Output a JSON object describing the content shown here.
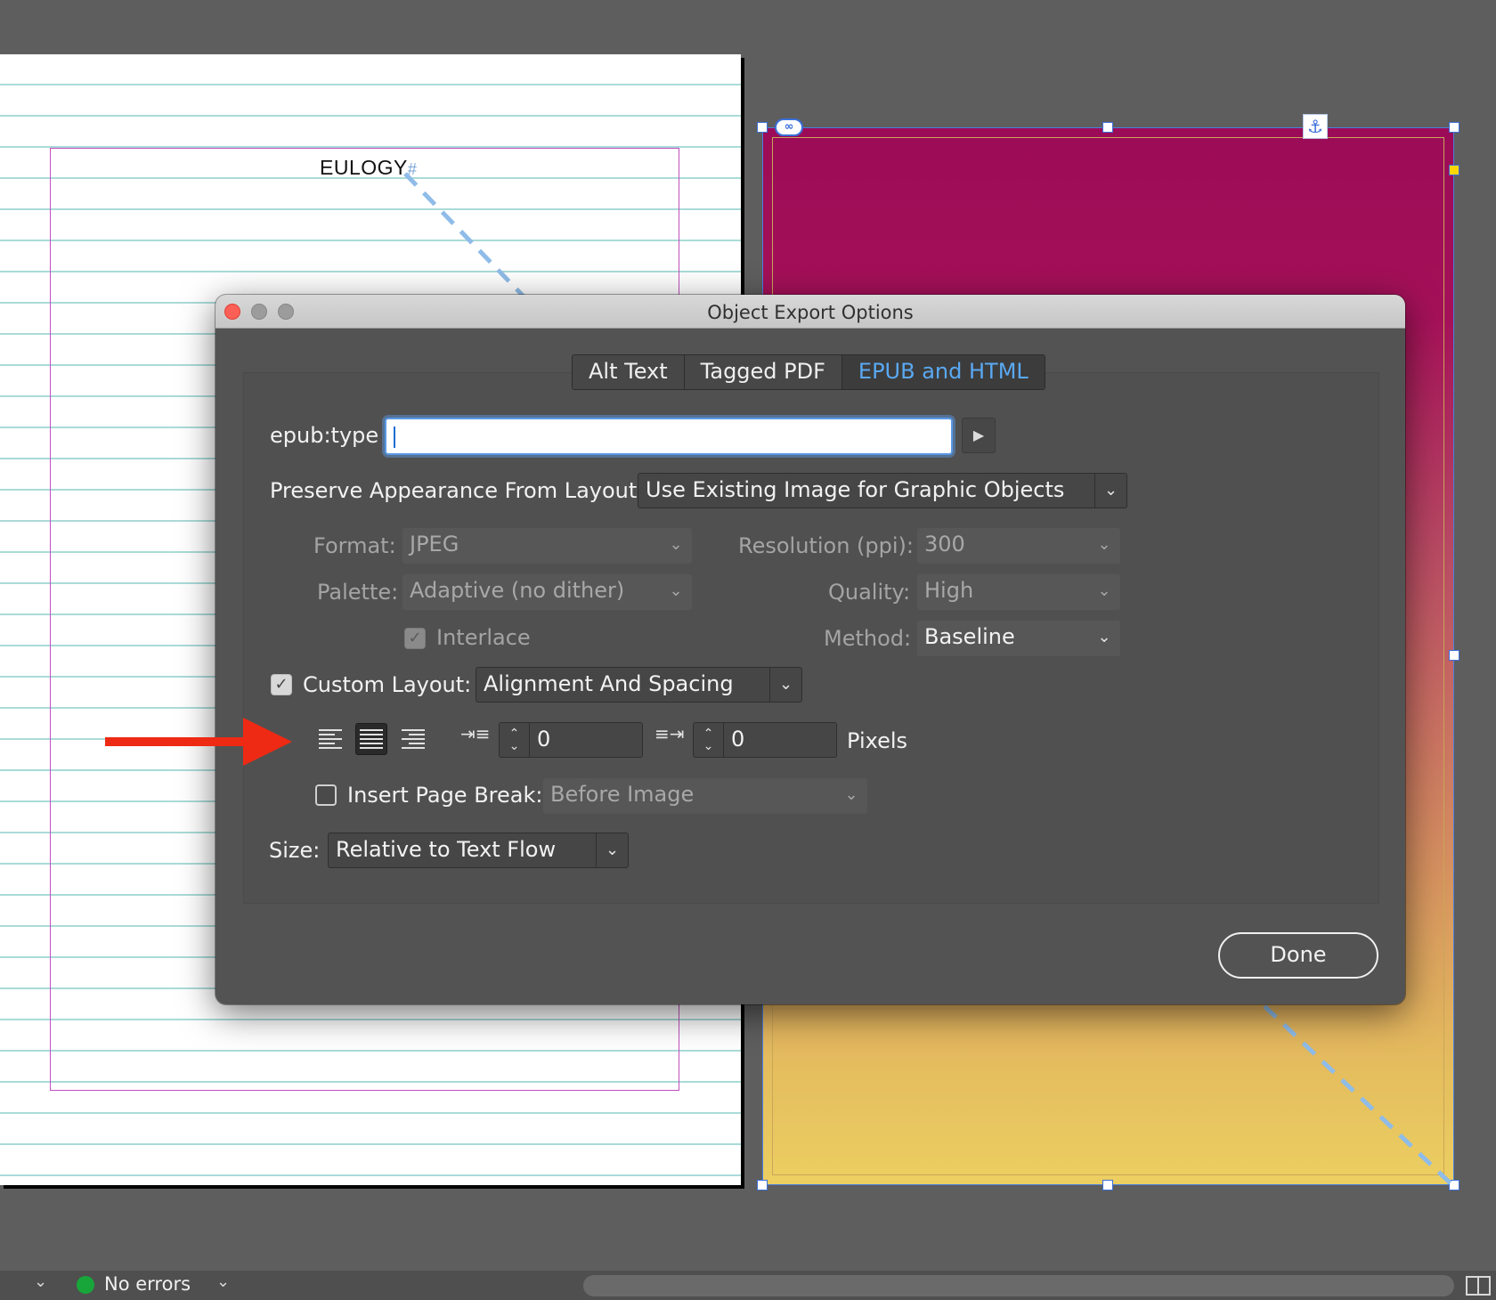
{
  "document": {
    "heading": "EULOGY",
    "hash_marker": "#"
  },
  "dialog": {
    "title": "Object Export Options",
    "tabs": [
      {
        "label": "Alt Text",
        "active": false
      },
      {
        "label": "Tagged PDF",
        "active": false
      },
      {
        "label": "EPUB and HTML",
        "active": true
      }
    ],
    "epub_type": {
      "label": "epub:type",
      "value": ""
    },
    "preserve": {
      "label": "Preserve Appearance From Layout:",
      "value": "Use Existing Image for Graphic Objects"
    },
    "format": {
      "label": "Format:",
      "value": "JPEG"
    },
    "resolution": {
      "label": "Resolution (ppi):",
      "value": "300"
    },
    "palette": {
      "label": "Palette:",
      "value": "Adaptive (no dither)"
    },
    "quality": {
      "label": "Quality:",
      "value": "High"
    },
    "interlace": {
      "label": "Interlace",
      "checked": true
    },
    "method": {
      "label": "Method:",
      "value": "Baseline"
    },
    "custom_layout": {
      "label": "Custom Layout:",
      "checked": true,
      "value": "Alignment And Spacing"
    },
    "alignment": {
      "selected": "center"
    },
    "space_before": "0",
    "space_after": "0",
    "units": "Pixels",
    "page_break": {
      "label": "Insert Page Break:",
      "checked": false,
      "value": "Before Image"
    },
    "size": {
      "label": "Size:",
      "value": "Relative to Text Flow"
    },
    "done_label": "Done"
  },
  "statusbar": {
    "status_text": "No errors",
    "status_color": "#18a63a"
  },
  "colors": {
    "accent": "#5aa9f3",
    "close_button": "#fb5f56",
    "annotation_arrow": "#ee2a14"
  }
}
